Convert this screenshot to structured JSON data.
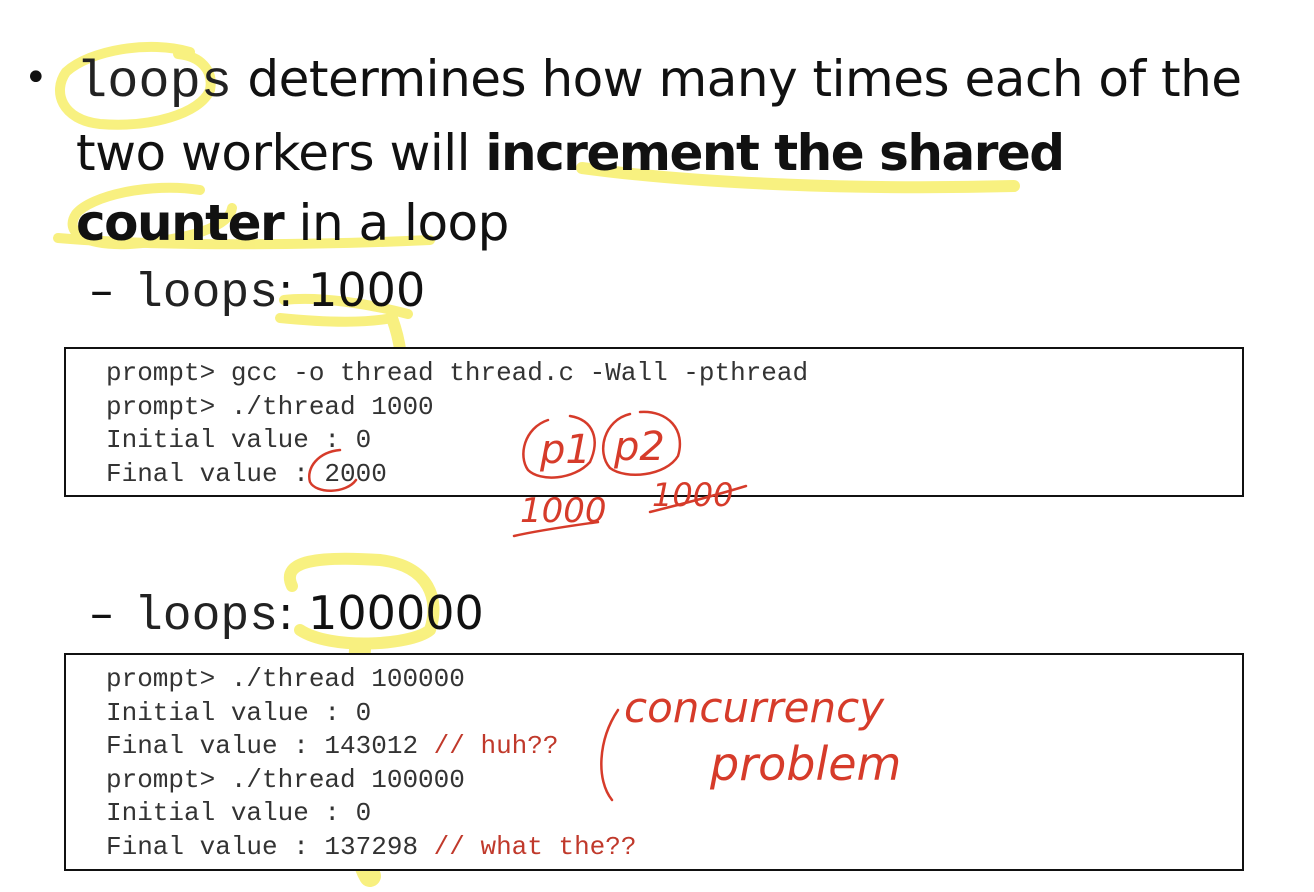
{
  "bullet": {
    "code_word": "loops",
    "text_a": " determines how many times each of the two workers will ",
    "bold_a": "increment the shared counter",
    "text_b": " in a loop"
  },
  "sub_items": [
    {
      "code": "loops",
      "value": ": 1000"
    },
    {
      "code": "loops",
      "value": ": 100000"
    }
  ],
  "code_blocks": [
    {
      "lines": [
        {
          "text": "prompt> gcc -o thread thread.c -Wall -pthread",
          "comment": ""
        },
        {
          "text": "prompt> ./thread 1000",
          "comment": ""
        },
        {
          "text": "Initial value : 0",
          "comment": ""
        },
        {
          "text": "Final value : 2000",
          "comment": ""
        }
      ]
    },
    {
      "lines": [
        {
          "text": "prompt> ./thread 100000",
          "comment": ""
        },
        {
          "text": "Initial value : 0",
          "comment": ""
        },
        {
          "text": "Final value : 143012 ",
          "comment": "// huh??"
        },
        {
          "text": "prompt> ./thread 100000",
          "comment": ""
        },
        {
          "text": "Initial value : 0",
          "comment": ""
        },
        {
          "text": "Final value : 137298 ",
          "comment": "// what the??"
        }
      ]
    }
  ],
  "handwriting": {
    "p1": "p1",
    "p2": "p2",
    "p1_count": "1000",
    "p2_count": "1000",
    "note_line1": "concurrency",
    "note_line2": "problem"
  },
  "colors": {
    "highlighter": "#f7ee6a",
    "ink": "#d63b2a",
    "comment": "#c0392b"
  }
}
